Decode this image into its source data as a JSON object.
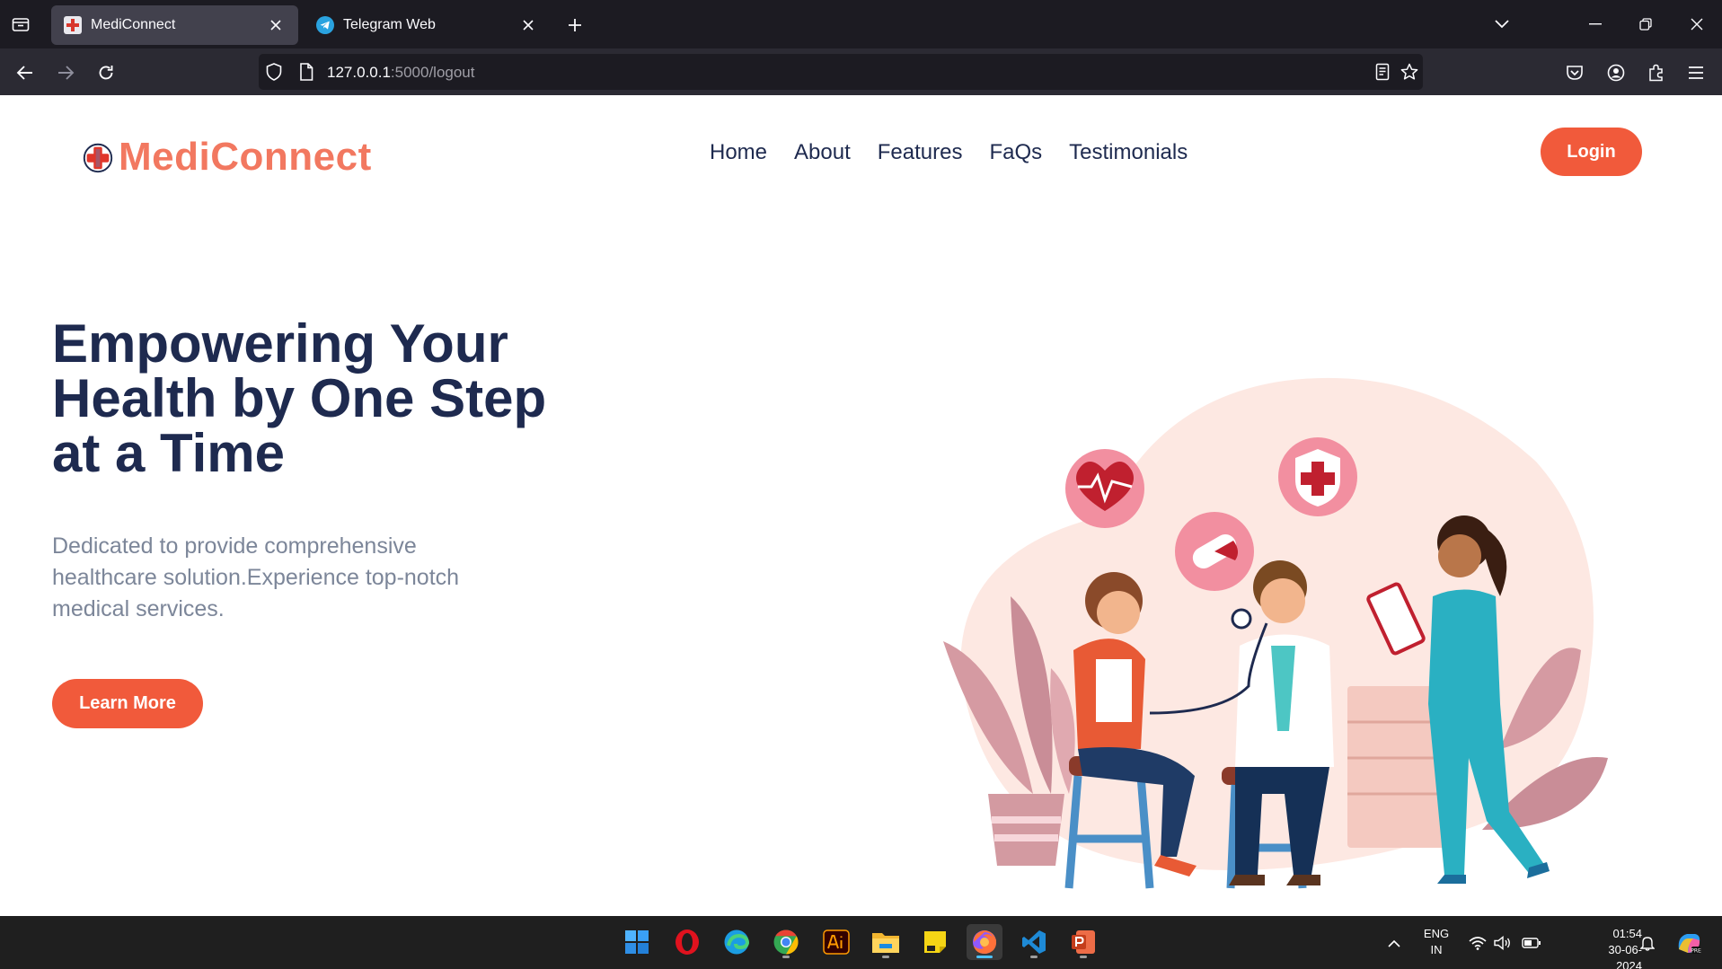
{
  "browser": {
    "tabs": [
      {
        "title": "MediConnect",
        "active": true,
        "favicon": "mediconnect-favicon"
      },
      {
        "title": "Telegram Web",
        "active": false,
        "favicon": "telegram-icon"
      }
    ],
    "url_host": "127.0.0.1",
    "url_path": ":5000/logout"
  },
  "site": {
    "brand": "MediConnect",
    "nav": [
      "Home",
      "About",
      "Features",
      "FaQs",
      "Testimonials"
    ],
    "login_label": "Login",
    "hero_title": "Empowering Your Health by One Step at a Time",
    "hero_subtitle": "Dedicated to provide comprehensive healthcare solution.Experience top-notch medical services.",
    "cta_label": "Learn More",
    "colors": {
      "accent": "#f15a3b",
      "logo": "#f27860",
      "heading": "#1e2a4f",
      "body_text": "#7c8699"
    }
  },
  "taskbar": {
    "apps": [
      "windows-start-icon",
      "opera-icon",
      "edge-icon",
      "chrome-icon",
      "illustrator-icon",
      "file-explorer-icon",
      "sticky-notes-icon",
      "firefox-icon",
      "vscode-icon",
      "powerpoint-icon"
    ],
    "language": "ENG",
    "region": "IN",
    "time": "01:54",
    "date": "30-06-2024"
  }
}
